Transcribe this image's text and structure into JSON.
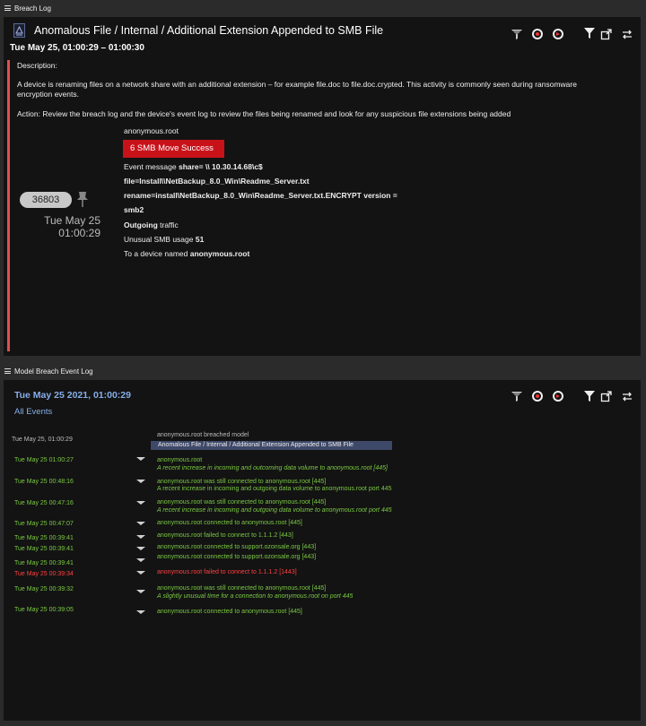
{
  "panels": {
    "breach_log_label": "Breach Log",
    "event_log_label": "Model Breach Event Log"
  },
  "breach": {
    "title": "Anomalous File / Internal / Additional Extension Appended to SMB File",
    "time_range": "Tue May 25, 01:00:29 – 01:00:30",
    "description_label": "Description:",
    "description": "A device is renaming files on a network share with an additional extension – for example file.doc to file.doc.crypted. This activity is commonly seen during ransomware encryption events.",
    "action": "Action: Review the breach log and the device's event log to review the files being renamed and look for any suspicious file extensions being added",
    "score": "36803",
    "date_line1": "Tue May 25",
    "date_line2": "01:00:29",
    "details": {
      "host": "anonymous.root",
      "badge": "6 SMB Move Success",
      "event_prefix": "Event message",
      "event_share": "share= \\\\ 10.30.14.68\\c$",
      "event_file": "file=Install\\\\NetBackup_8.0_Win\\Readme_Server.txt",
      "event_rename": "rename=install\\NetBackup_8.0_Win\\Readme_Server.txt.ENCRYPT version =",
      "event_version": "smb2",
      "traffic_bold": "Outgoing",
      "traffic_rest": "traffic",
      "usage_label": "Unusual SMB usage",
      "usage_value": "51",
      "device_label": "To a device named",
      "device_name": "anonymous.root"
    }
  },
  "event_log": {
    "date": "Tue May 25 2021, 01:00:29",
    "filter": "All Events",
    "model_row": {
      "time": "Tue May 25, 01:00:29",
      "label": "anonymous.root breached model",
      "chip": "Anomalous File / Internal / Additional Extension Appended to SMB File"
    },
    "rows": [
      {
        "time": "Tue May 25 01:00:27",
        "msg": "anonymous.root",
        "sub": "A recent increase in incoming and outcoming data volume to anonymous.root [445]"
      },
      {
        "time": "Tue May 25 00:48:16",
        "msg": "anonymous.root was still connected to anonymous.root [445]",
        "sub": "A recent increase in incoming and outgoing data volume to anonymous.root port 445"
      },
      {
        "time": "Tue May 25 00:47:16",
        "msg": "anonymous.root was still connected to anonymous.root [445]",
        "sub": "A recent increase in incoming and outgoing data volume to anonymous.root  port 445"
      },
      {
        "time": "Tue May 25 00:47:07",
        "msg": "anonymous.root connected to anonymous.root [445]",
        "sub": ""
      },
      {
        "time": "Tue May 25 00:39:41",
        "msg": "anonymous.root failed to connect to 1.1.1.2 [443]",
        "sub": ""
      },
      {
        "time": "Tue May 25 00:39:41",
        "msg": "anonymous.root connected to support.ozonsale.org [443]",
        "sub": ""
      },
      {
        "time": "Tue May 25 00:39:41",
        "msg": "anonymous.root connected to support.ozonsale.org [443]",
        "sub": ""
      },
      {
        "time": "Tue May 25 00:39:34",
        "msg": "anonymous.root failed to connect to 1.1.1.2 [1443]",
        "sub": ""
      },
      {
        "time": "Tue May 25 00:39:32",
        "msg": "anonymous.root was still connected to anonymous.root [445]",
        "sub": "A slightly unusual time for a connection to anonymous.root on port 445"
      },
      {
        "time": "Tue May 25 00:39:05",
        "msg": "anonymous.root connected to anonymous.root [445]",
        "sub": ""
      }
    ]
  },
  "colors": {
    "accent": "#e05050",
    "badge": "#c8121a",
    "link": "#86aeea",
    "green": "#7ac943",
    "red": "#ff4040"
  },
  "icons": [
    "model-icon",
    "pin-icon",
    "filter-funnel-icon",
    "reset-icon",
    "replay-icon",
    "filter-icon",
    "popout-icon",
    "swap-icon",
    "menu-icon",
    "expand-caret-icon"
  ]
}
